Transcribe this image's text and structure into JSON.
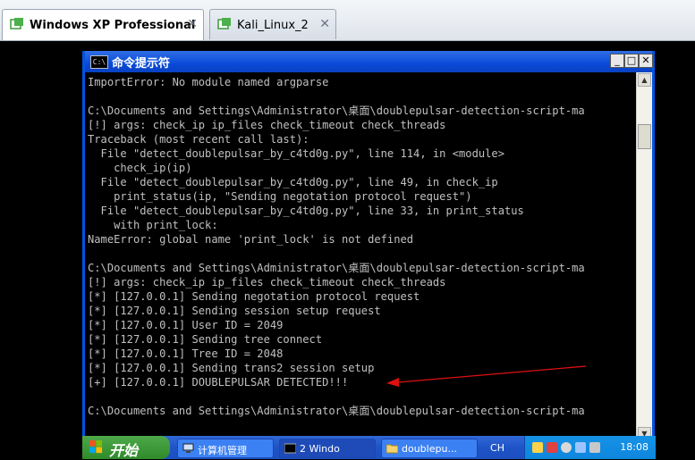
{
  "vm_tabs": [
    {
      "label": "Windows XP Professional",
      "active": true
    },
    {
      "label": "Kali_Linux_2",
      "active": false
    }
  ],
  "tab_close_glyph": "✕",
  "window": {
    "title": "命令提示符",
    "icon_text": "C:\\",
    "minimize_glyph": "_",
    "maximize_glyph": "□",
    "close_glyph": "✕"
  },
  "console_text": "ImportError: No module named argparse\n\nC:\\Documents and Settings\\Administrator\\桌面\\doublepulsar-detection-script-ma\n[!] args: check_ip ip_files check_timeout check_threads\nTraceback (most recent call last):\n  File \"detect_doublepulsar_by_c4td0g.py\", line 114, in <module>\n    check_ip(ip)\n  File \"detect_doublepulsar_by_c4td0g.py\", line 49, in check_ip\n    print_status(ip, \"Sending negotation protocol request\")\n  File \"detect_doublepulsar_by_c4td0g.py\", line 33, in print_status\n    with print_lock:\nNameError: global name 'print_lock' is not defined\n\nC:\\Documents and Settings\\Administrator\\桌面\\doublepulsar-detection-script-ma\n[!] args: check_ip ip_files check_timeout check_threads\n[*] [127.0.0.1] Sending negotation protocol request\n[*] [127.0.0.1] Sending session setup request\n[*] [127.0.0.1] User ID = 2049\n[*] [127.0.0.1] Sending tree connect\n[*] [127.0.0.1] Tree ID = 2048\n[*] [127.0.0.1] Sending trans2 session setup\n[+] [127.0.0.1] DOUBLEPULSAR DETECTED!!!\n\nC:\\Documents and Settings\\Administrator\\桌面\\doublepulsar-detection-script-ma",
  "taskbar": {
    "start_label": "开始",
    "items": [
      {
        "label": "计算机管理",
        "pressed": false
      },
      {
        "label": "2 Windo",
        "pressed": true
      },
      {
        "label": "doublepu...",
        "pressed": false
      }
    ],
    "language": "CH",
    "clock": "18:08"
  },
  "colors": {
    "console_bg": "#000000",
    "console_fg": "#c0c0c0",
    "annotation_arrow": "#e01010",
    "xp_blue": "#0054e3"
  }
}
